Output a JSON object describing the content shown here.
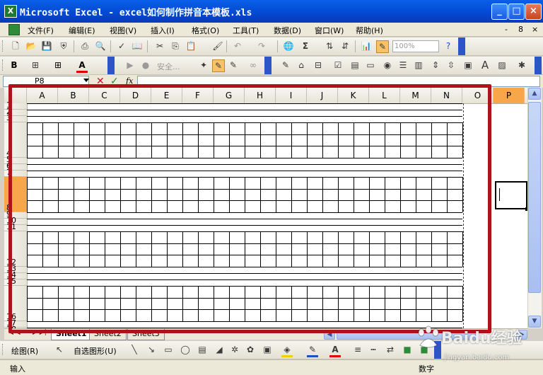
{
  "window": {
    "title": "Microsoft Excel - excel如何制作拼音本模板.xls",
    "app_icon_letter": "X",
    "minimize": "_",
    "maximize": "□",
    "close": "×"
  },
  "menu": {
    "items": [
      "文件(F)",
      "编辑(E)",
      "视图(V)",
      "插入(I)",
      "格式(O)",
      "工具(T)",
      "数据(D)",
      "窗口(W)",
      "帮助(H)"
    ],
    "right_controls": [
      "-",
      "8",
      "×"
    ]
  },
  "toolbar_standard": {
    "zoom_value": "100%"
  },
  "toolbar_formatting": {
    "bold_label": "B",
    "security_label": "安全..."
  },
  "formula_bar": {
    "name_box": "P8",
    "fx_label": "fx"
  },
  "sheet": {
    "columns": [
      "A",
      "B",
      "C",
      "D",
      "E",
      "F",
      "G",
      "H",
      "I",
      "J",
      "K",
      "L",
      "M",
      "N",
      "O",
      "P"
    ],
    "selected_column": "P",
    "rows": [
      "1",
      "2",
      "3",
      "4",
      "5",
      "6",
      "7",
      "8",
      "9",
      "10",
      "11",
      "12",
      "13",
      "14",
      "15",
      "16",
      "17",
      "18"
    ],
    "selected_row": "8",
    "active_cell": "P8"
  },
  "sheet_tabs": [
    "Sheet1",
    "Sheet2",
    "Sheet3"
  ],
  "draw_toolbar": {
    "draw_label": "绘图(R)",
    "autoshapes_label": "自选图形(U)"
  },
  "status": {
    "left": "输入",
    "mode": "数字"
  },
  "watermark": {
    "brand": "Baidu经验",
    "url": "jingyan.baidu.com"
  },
  "colors": {
    "title_bar": "#0348d0",
    "highlight_box": "#b0121a",
    "selected_header": "#f7a64a"
  }
}
